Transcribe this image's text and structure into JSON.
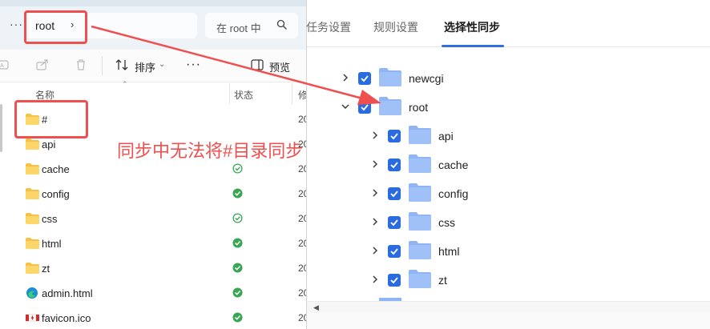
{
  "explorer": {
    "address": {
      "crumb": "root",
      "chevron": "›"
    },
    "search_placeholder": "在 root 中",
    "toolbar": {
      "sort_label": "排序",
      "more": "···",
      "preview_label": "预览"
    },
    "columns": {
      "name": "名称",
      "status": "状态",
      "modified": "修"
    },
    "files": [
      {
        "name": "#",
        "type": "folder",
        "status": "",
        "date": "20"
      },
      {
        "name": "api",
        "type": "folder",
        "status": "",
        "date": "20"
      },
      {
        "name": "cache",
        "type": "folder",
        "status": "synced-outline",
        "date": "20"
      },
      {
        "name": "config",
        "type": "folder",
        "status": "synced",
        "date": "20"
      },
      {
        "name": "css",
        "type": "folder",
        "status": "synced-outline",
        "date": "20"
      },
      {
        "name": "html",
        "type": "folder",
        "status": "synced",
        "date": "20"
      },
      {
        "name": "zt",
        "type": "folder",
        "status": "synced",
        "date": "20"
      },
      {
        "name": "admin.html",
        "type": "edge-html",
        "status": "synced",
        "date": "20"
      },
      {
        "name": "favicon.ico",
        "type": "ico",
        "status": "synced",
        "date": "20"
      }
    ]
  },
  "sync_panel": {
    "tabs": [
      {
        "label": "任务设置",
        "active": false
      },
      {
        "label": "规则设置",
        "active": false
      },
      {
        "label": "选择性同步",
        "active": true
      }
    ],
    "tree": [
      {
        "label": "newcgi",
        "depth": 0,
        "expanded": false,
        "checked": true
      },
      {
        "label": "root",
        "depth": 0,
        "expanded": true,
        "checked": true
      },
      {
        "label": "api",
        "depth": 1,
        "expanded": false,
        "checked": true
      },
      {
        "label": "cache",
        "depth": 1,
        "expanded": false,
        "checked": true
      },
      {
        "label": "config",
        "depth": 1,
        "expanded": false,
        "checked": true
      },
      {
        "label": "css",
        "depth": 1,
        "expanded": false,
        "checked": true
      },
      {
        "label": "html",
        "depth": 1,
        "expanded": false,
        "checked": true
      },
      {
        "label": "zt",
        "depth": 1,
        "expanded": false,
        "checked": true
      }
    ]
  },
  "annotation": {
    "text": "同步中无法将#目录同步",
    "color": "#ee4f4f"
  },
  "colors": {
    "accent": "#2a6ce0",
    "folder_yellow": "#f5c247",
    "folder_blue": "#8fb5f5",
    "status_green": "#3aa655"
  }
}
